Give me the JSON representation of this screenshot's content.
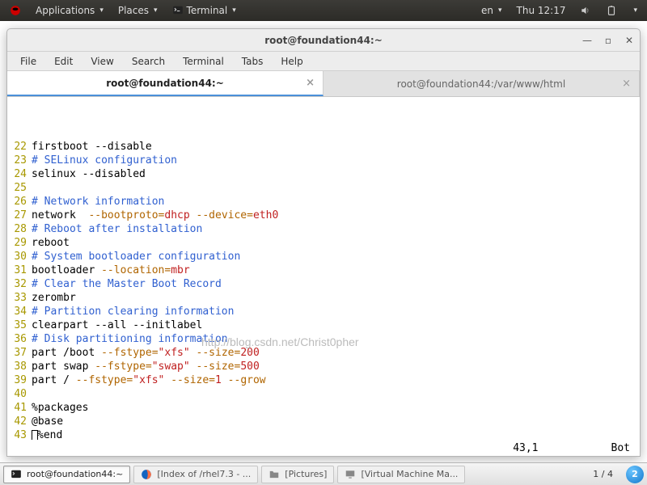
{
  "panel": {
    "applications": "Applications",
    "places": "Places",
    "terminal": "Terminal",
    "lang": "en",
    "clock": "Thu 12:17"
  },
  "window": {
    "title": "root@foundation44:~",
    "menus": [
      "File",
      "Edit",
      "View",
      "Search",
      "Terminal",
      "Tabs",
      "Help"
    ],
    "tabs": [
      {
        "label": "root@foundation44:~",
        "active": true
      },
      {
        "label": "root@foundation44:/var/www/html",
        "active": false
      }
    ],
    "status": {
      "pos": "43,1",
      "scroll": "Bot"
    }
  },
  "watermark": "http://blog.csdn.net/Christ0pher",
  "lines": [
    {
      "n": 22,
      "t": [
        [
          "",
          "firstboot --disable"
        ]
      ]
    },
    {
      "n": 23,
      "t": [
        [
          "c",
          "# SELinux configuration"
        ]
      ]
    },
    {
      "n": 24,
      "t": [
        [
          "",
          "selinux --disabled"
        ]
      ]
    },
    {
      "n": 25,
      "t": [
        [
          "",
          ""
        ]
      ]
    },
    {
      "n": 26,
      "t": [
        [
          "c",
          "# Network information"
        ]
      ]
    },
    {
      "n": 27,
      "t": [
        [
          "",
          "network  "
        ],
        [
          "o",
          "--bootproto="
        ],
        [
          "s",
          "dhcp"
        ],
        [
          "",
          " "
        ],
        [
          "o",
          "--device="
        ],
        [
          "s",
          "eth0"
        ]
      ]
    },
    {
      "n": 28,
      "t": [
        [
          "c",
          "# Reboot after installation"
        ]
      ]
    },
    {
      "n": 29,
      "t": [
        [
          "",
          "reboot"
        ]
      ]
    },
    {
      "n": 30,
      "t": [
        [
          "c",
          "# System bootloader configuration"
        ]
      ]
    },
    {
      "n": 31,
      "t": [
        [
          "",
          "bootloader "
        ],
        [
          "o",
          "--location="
        ],
        [
          "s",
          "mbr"
        ]
      ]
    },
    {
      "n": 32,
      "t": [
        [
          "c",
          "# Clear the Master Boot Record"
        ]
      ]
    },
    {
      "n": 33,
      "t": [
        [
          "",
          "zerombr"
        ]
      ]
    },
    {
      "n": 34,
      "t": [
        [
          "c",
          "# Partition clearing information"
        ]
      ]
    },
    {
      "n": 35,
      "t": [
        [
          "",
          "clearpart --all --initlabel"
        ]
      ]
    },
    {
      "n": 36,
      "t": [
        [
          "c",
          "# Disk partitioning information"
        ]
      ]
    },
    {
      "n": 37,
      "t": [
        [
          "",
          "part /boot "
        ],
        [
          "o",
          "--fstype="
        ],
        [
          "s",
          "\"xfs\""
        ],
        [
          "",
          " "
        ],
        [
          "o",
          "--size="
        ],
        [
          "s",
          "200"
        ]
      ]
    },
    {
      "n": 38,
      "t": [
        [
          "",
          "part swap "
        ],
        [
          "o",
          "--fstype="
        ],
        [
          "s",
          "\"swap\""
        ],
        [
          "",
          " "
        ],
        [
          "o",
          "--size="
        ],
        [
          "s",
          "500"
        ]
      ]
    },
    {
      "n": 39,
      "t": [
        [
          "",
          "part / "
        ],
        [
          "o",
          "--fstype="
        ],
        [
          "s",
          "\"xfs\""
        ],
        [
          "",
          " "
        ],
        [
          "o",
          "--size="
        ],
        [
          "s",
          "1"
        ],
        [
          "",
          " "
        ],
        [
          "o",
          "--grow"
        ]
      ]
    },
    {
      "n": 40,
      "t": [
        [
          "",
          ""
        ]
      ]
    },
    {
      "n": 41,
      "t": [
        [
          "",
          "%packages"
        ]
      ]
    },
    {
      "n": 42,
      "t": [
        [
          "",
          "@base"
        ]
      ]
    },
    {
      "n": 43,
      "t": [
        [
          "cursor",
          ""
        ],
        [
          "",
          "%end"
        ]
      ],
      "cursor": true
    }
  ],
  "taskbar": {
    "tasks": [
      {
        "label": "root@foundation44:~",
        "icon": "terminal",
        "active": true
      },
      {
        "label": "[Index of /rhel7.3 - ...",
        "icon": "firefox",
        "active": false
      },
      {
        "label": "[Pictures]",
        "icon": "files",
        "active": false
      },
      {
        "label": "[Virtual Machine Ma...",
        "icon": "vm",
        "active": false
      }
    ],
    "workspace": "1 / 4",
    "tray_number": "2"
  }
}
